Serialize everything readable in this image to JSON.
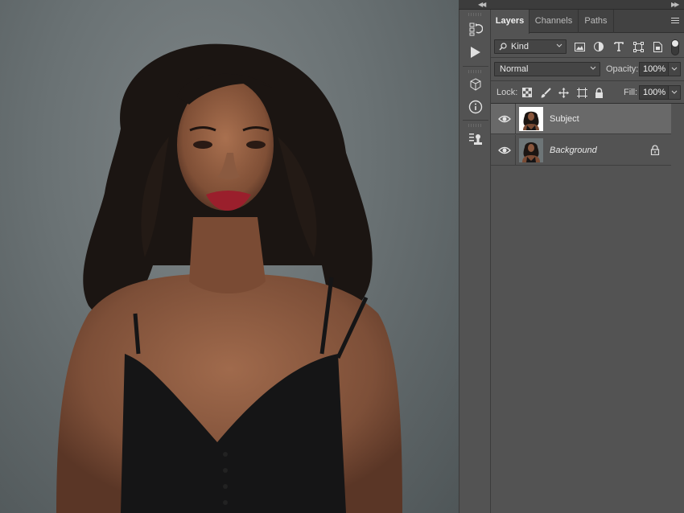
{
  "panel": {
    "tabs": [
      {
        "label": "Layers",
        "active": true
      },
      {
        "label": "Channels",
        "active": false
      },
      {
        "label": "Paths",
        "active": false
      }
    ]
  },
  "filter": {
    "kind_label": "Kind",
    "filter_icons": [
      "image-filter-icon",
      "adjustment-filter-icon",
      "type-filter-icon",
      "shape-filter-icon",
      "smart-object-filter-icon"
    ]
  },
  "blend": {
    "mode": "Normal",
    "opacity_label": "Opacity:",
    "opacity_value": "100%"
  },
  "lock": {
    "label": "Lock:",
    "icons": [
      "lock-transparent-pixels-icon",
      "lock-image-pixels-icon",
      "lock-position-icon",
      "lock-artboard-icon",
      "lock-all-icon"
    ],
    "fill_label": "Fill:",
    "fill_value": "100%"
  },
  "layers": [
    {
      "name": "Subject",
      "selected": true,
      "visible": true,
      "locked": false
    },
    {
      "name": "Background",
      "selected": false,
      "visible": true,
      "locked": true
    }
  ],
  "toolstrip": {
    "tools": [
      "history-icon",
      "actions-play-icon",
      "3d-icon",
      "info-icon",
      "clone-source-icon"
    ]
  },
  "colors": {
    "panel_bg": "#535353",
    "tab_bar_bg": "#424242",
    "selected_layer_bg": "#696969",
    "canvas_bg": "#6d7577"
  }
}
